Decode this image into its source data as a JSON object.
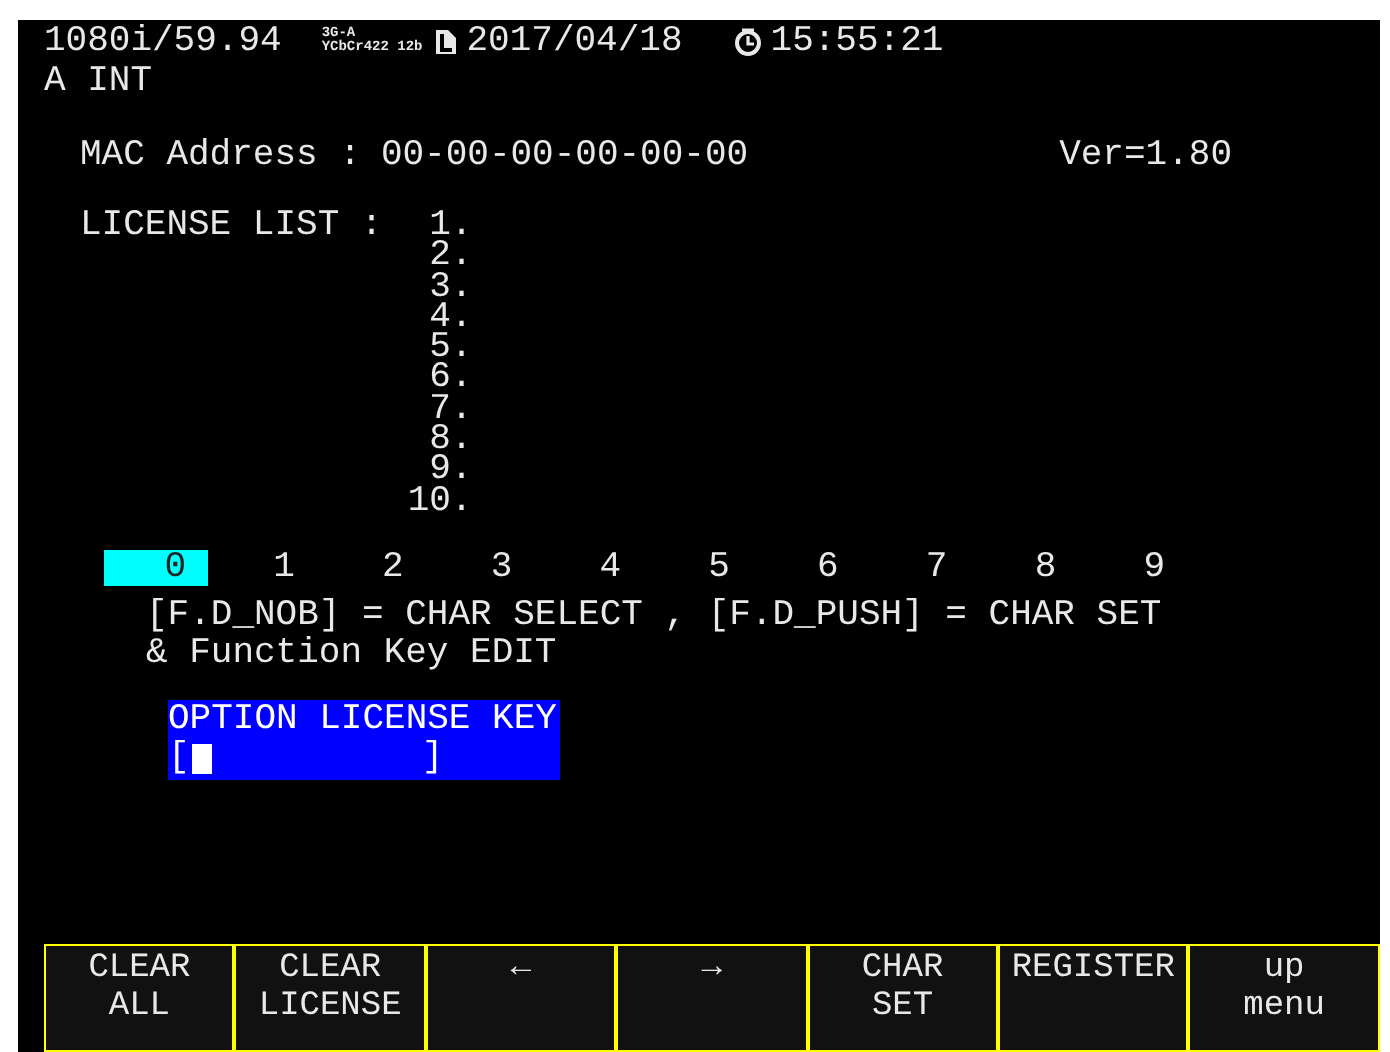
{
  "status": {
    "format": "1080i/59.94",
    "signal_top": "3G-A",
    "signal_bottom": "YCbCr422 12b",
    "date": "2017/04/18",
    "time": "15:55:21",
    "input": "A INT"
  },
  "mac": {
    "label": "MAC Address :",
    "value": "00-00-00-00-00-00"
  },
  "version": "Ver=1.80",
  "license_list": {
    "label": "LICENSE LIST :",
    "items": [
      "1.",
      "2.",
      "3.",
      "4.",
      "5.",
      "6.",
      "7.",
      "8.",
      "9.",
      "10."
    ]
  },
  "char_selector": [
    {
      "label": "0",
      "selected": true
    },
    {
      "label": "1",
      "selected": false
    },
    {
      "label": "2",
      "selected": false
    },
    {
      "label": "3",
      "selected": false
    },
    {
      "label": "4",
      "selected": false
    },
    {
      "label": "5",
      "selected": false
    },
    {
      "label": "6",
      "selected": false
    },
    {
      "label": "7",
      "selected": false
    },
    {
      "label": "8",
      "selected": false
    },
    {
      "label": "9",
      "selected": false
    }
  ],
  "instructions": [
    "[F.D_NOB] = CHAR SELECT , [F.D_PUSH] = CHAR SET",
    "& Function Key EDIT"
  ],
  "license_key": {
    "title": "OPTION LICENSE KEY",
    "open": "[",
    "close": "]"
  },
  "function_keys": [
    {
      "lines": [
        "CLEAR",
        "ALL"
      ]
    },
    {
      "lines": [
        "CLEAR",
        "LICENSE"
      ]
    },
    {
      "lines": [
        "←"
      ]
    },
    {
      "lines": [
        "→"
      ]
    },
    {
      "lines": [
        "CHAR",
        "SET"
      ]
    },
    {
      "lines": [
        "REGISTER"
      ]
    },
    {
      "lines": [
        "up",
        "menu"
      ]
    }
  ]
}
